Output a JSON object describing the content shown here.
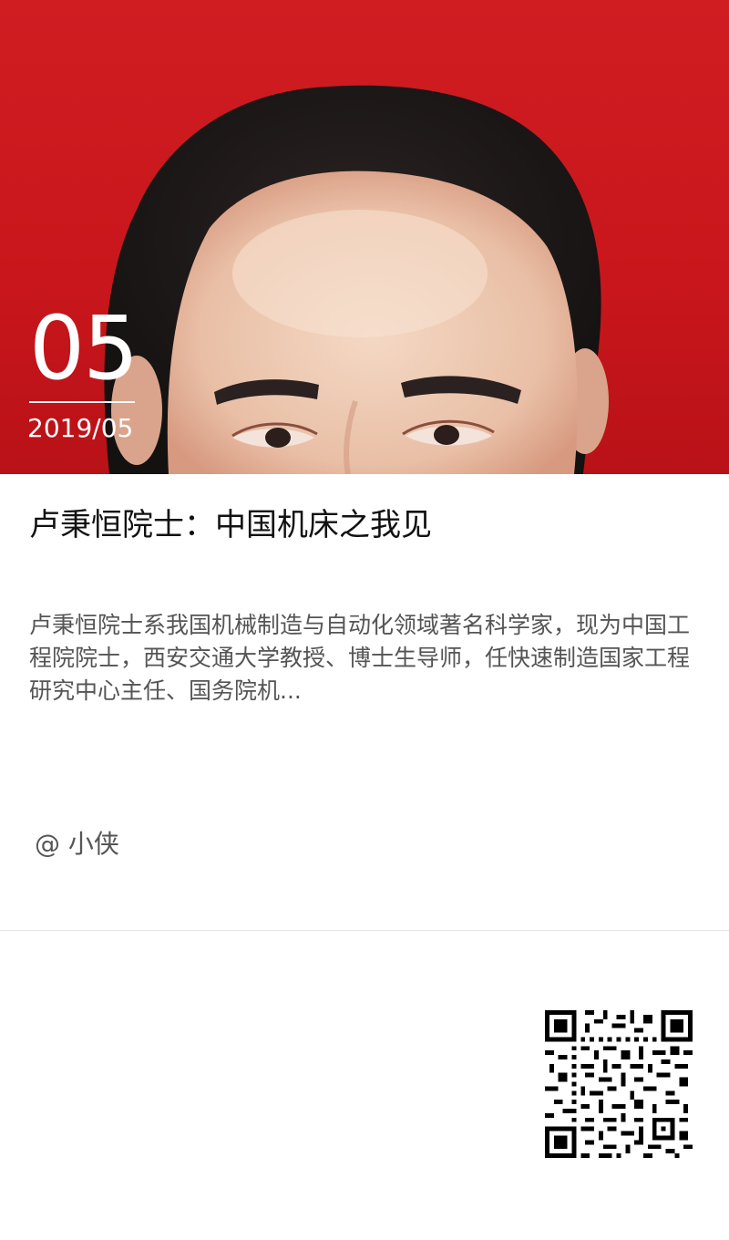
{
  "hero": {
    "day": "05",
    "date": "2019/05",
    "photo_icon": "portrait-photo",
    "background_color": "#c8161c"
  },
  "article": {
    "title": "卢秉恒院士：中国机床之我见",
    "summary": "卢秉恒院士系我国机械制造与自动化领域著名科学家，现为中国工程院院士，西安交通大学教授、博士生导师，任快速制造国家工程研究中心主任、国务院机...",
    "author": "@ 小侠"
  },
  "footer": {
    "qr_icon": "qr-code-icon"
  }
}
